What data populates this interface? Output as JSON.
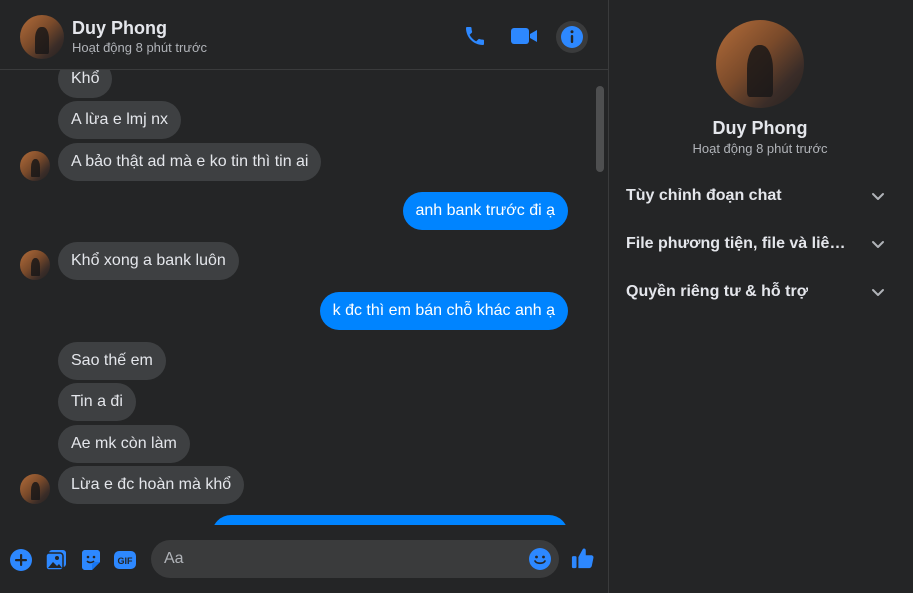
{
  "header": {
    "name": "Duy Phong",
    "status": "Hoạt động 8 phút trước"
  },
  "messages": [
    {
      "side": "in",
      "text": "Khổ"
    },
    {
      "side": "in",
      "text": "A lừa e lmj nx"
    },
    {
      "side": "in",
      "text": "A bảo thật ad mà e ko tin thì tin ai"
    },
    {
      "side": "out",
      "text": "anh bank trước đi ạ"
    },
    {
      "side": "in",
      "text": "Khổ xong a bank luôn"
    },
    {
      "side": "out",
      "text": "k đc thì em bán chỗ khác anh ạ"
    },
    {
      "side": "in",
      "text": "Sao thế em"
    },
    {
      "side": "in",
      "text": "Tin a đi"
    },
    {
      "side": "in",
      "text": "Ae mk còn làm"
    },
    {
      "side": "in",
      "text": "Lừa e đc hoàn mà khổ"
    },
    {
      "side": "out",
      "text": ""
    }
  ],
  "composer": {
    "placeholder": "Aa"
  },
  "info": {
    "name": "Duy Phong",
    "status": "Hoạt động 8 phút trước",
    "items": [
      {
        "label": "Tùy chỉnh đoạn chat"
      },
      {
        "label": "File phương tiện, file và liên kết"
      },
      {
        "label": "Quyền riêng tư & hỗ trợ"
      }
    ]
  },
  "colors": {
    "background": "#242526",
    "accent": "#0084ff",
    "incoming_bubble": "#3e4042",
    "icon_blue": "#2d88ff"
  },
  "icons": [
    "phone-icon",
    "video-camera-icon",
    "info-icon",
    "plus-circle-icon",
    "image-icon",
    "sticker-icon",
    "gif-icon",
    "emoji-icon",
    "thumbs-up-icon",
    "chevron-down-icon"
  ]
}
